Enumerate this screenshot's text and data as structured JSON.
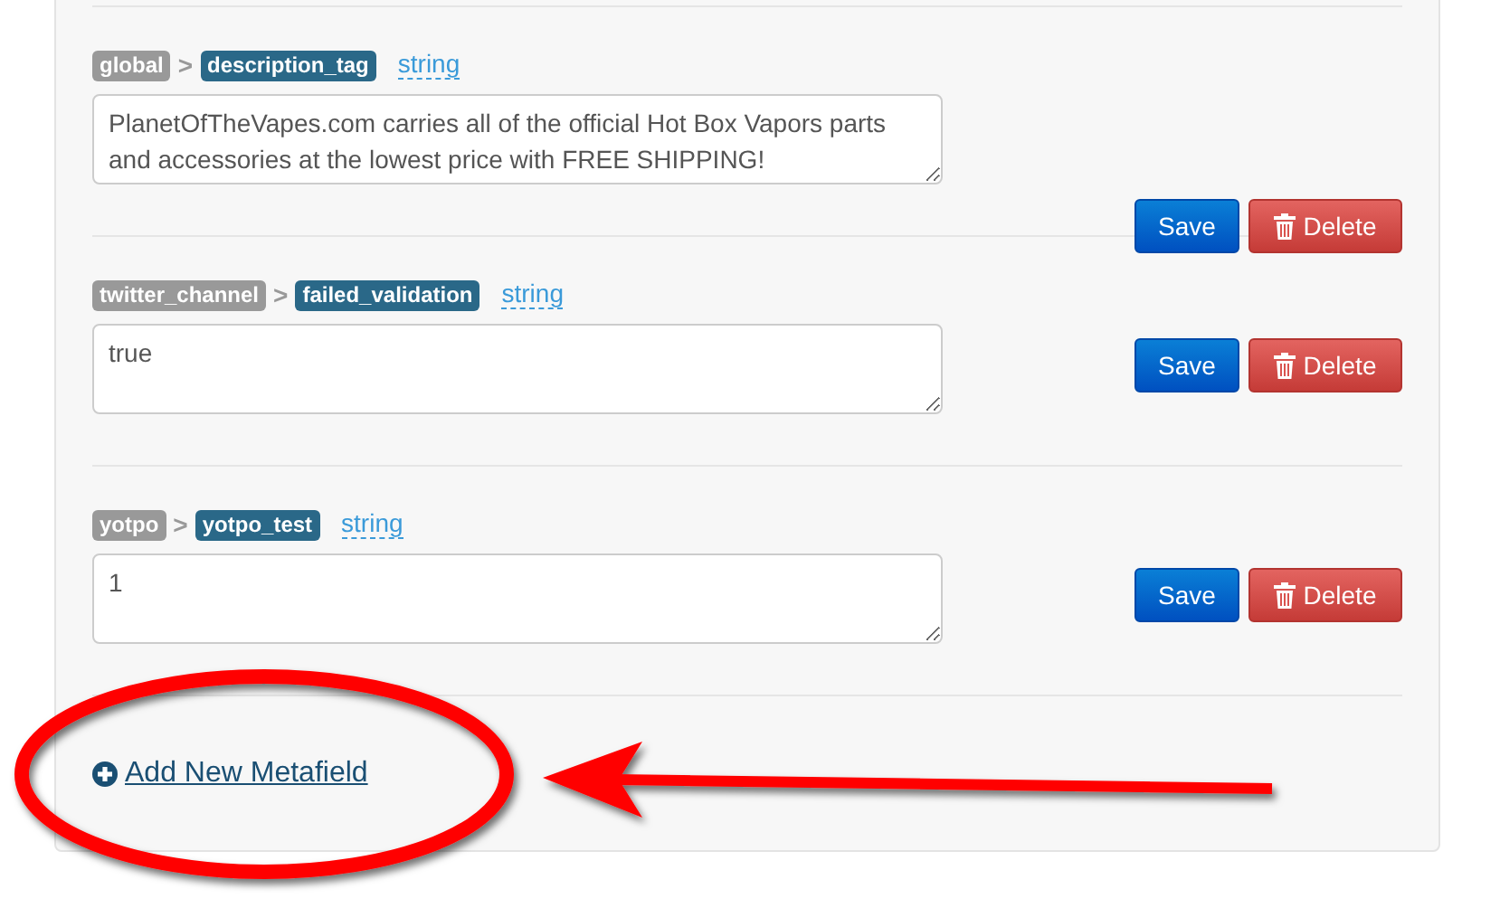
{
  "metafields": [
    {
      "namespace": "global",
      "key": "description_tag",
      "type": "string",
      "value": "PlanetOfTheVapes.com carries all of the official Hot Box Vapors parts and accessories at the lowest price with FREE SHIPPING!",
      "save": "Save",
      "delete": "Delete"
    },
    {
      "namespace": "twitter_channel",
      "key": "failed_validation",
      "type": "string",
      "value": "true",
      "save": "Save",
      "delete": "Delete"
    },
    {
      "namespace": "yotpo",
      "key": "yotpo_test",
      "type": "string",
      "value": "1",
      "save": "Save",
      "delete": "Delete"
    }
  ],
  "separator": ">",
  "add_link": "Add New Metafield"
}
